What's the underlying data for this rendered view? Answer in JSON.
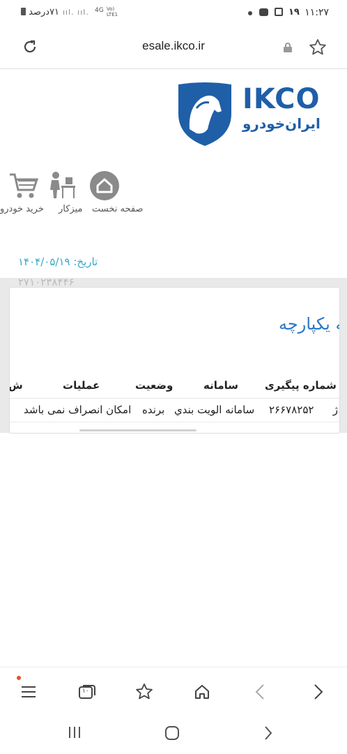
{
  "status_bar": {
    "time": "۱۱:۲۷",
    "date_day": "۱۹",
    "battery": "۷۱درصد",
    "network": "4G"
  },
  "browser": {
    "url": "esale.ikco.ir"
  },
  "logo": {
    "brand": "IKCO",
    "subtitle": "ایران‌خودرو"
  },
  "nav": {
    "home_label": "صفحه نخست",
    "desk_label": "میزکار",
    "buy_label": "خرید خودرو"
  },
  "info": {
    "date": "تاریخ: ۱۴۰۴/۰۵/۱۹",
    "code": "۲۷۱۰۲۳۸۴۴۶"
  },
  "card": {
    "title": "نه یکپارچه",
    "columns": [
      "شماره پیگیری",
      "سامانه",
      "وضعیت",
      "عملیات",
      "ش"
    ],
    "row": {
      "prefix": "ژ",
      "tracking": "۲۶۶۷۸۲۵۲",
      "system": "سامانه الويت بندي",
      "status": "برنده",
      "action": "امکان انصراف نمی باشد"
    }
  },
  "bottom_nav": {
    "tabs_count": "۱۰"
  }
}
